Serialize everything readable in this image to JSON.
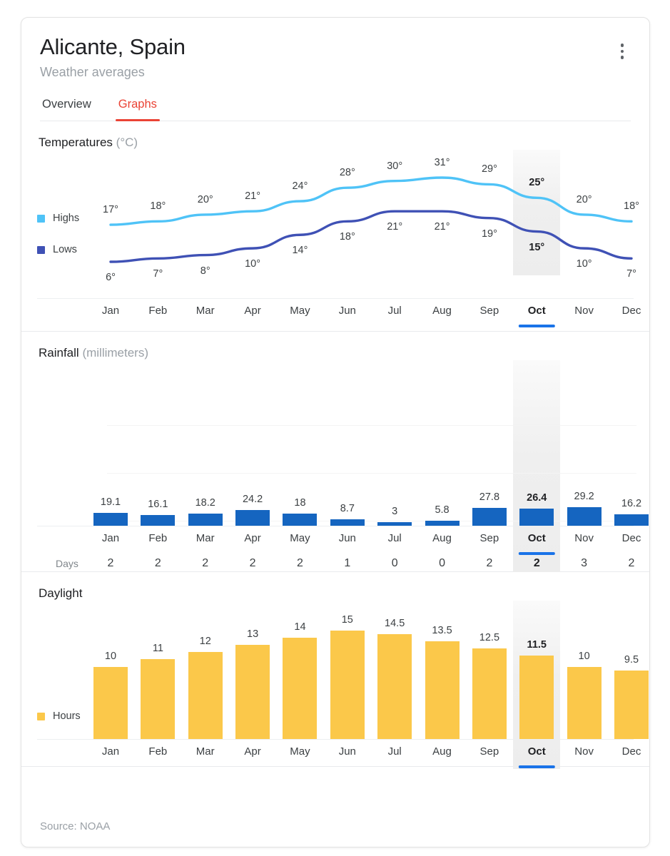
{
  "header": {
    "title": "Alicante, Spain",
    "subtitle": "Weather averages",
    "menu_icon": "more-vert-icon"
  },
  "tabs": [
    {
      "label": "Overview",
      "active": false
    },
    {
      "label": "Graphs",
      "active": true
    }
  ],
  "accent_color": "#ea4335",
  "selected_month": "Oct",
  "selected_index": 9,
  "footer": {
    "source": "Source: NOAA"
  },
  "sections": {
    "temperatures": {
      "title": "Temperatures",
      "unit": "(°C)"
    },
    "rainfall": {
      "title": "Rainfall",
      "unit": "(millimeters)"
    },
    "daylight": {
      "title": "Daylight",
      "unit": ""
    }
  },
  "rainfall_days_label": "Days",
  "chart_data": [
    {
      "type": "line",
      "title": "Temperatures (°C)",
      "xlabel": "",
      "ylabel": "°C",
      "categories": [
        "Jan",
        "Feb",
        "Mar",
        "Apr",
        "May",
        "Jun",
        "Jul",
        "Aug",
        "Sep",
        "Oct",
        "Nov",
        "Dec"
      ],
      "series": [
        {
          "name": "Highs",
          "color": "#4FC3F7",
          "values": [
            17,
            18,
            20,
            21,
            24,
            28,
            30,
            31,
            29,
            25,
            20,
            18
          ],
          "labels": [
            "17°",
            "18°",
            "20°",
            "21°",
            "24°",
            "28°",
            "30°",
            "31°",
            "29°",
            "25°",
            "20°",
            "18°"
          ]
        },
        {
          "name": "Lows",
          "color": "#3F51B5",
          "values": [
            6,
            7,
            8,
            10,
            14,
            18,
            21,
            21,
            19,
            15,
            10,
            7
          ],
          "labels": [
            "6°",
            "7°",
            "8°",
            "10°",
            "14°",
            "18°",
            "21°",
            "21°",
            "19°",
            "15°",
            "10°",
            "7°"
          ]
        }
      ],
      "ylim": [
        0,
        35
      ],
      "grid": false,
      "legend": "left"
    },
    {
      "type": "bar",
      "title": "Rainfall (millimeters)",
      "xlabel": "",
      "ylabel": "millimeters",
      "categories": [
        "Jan",
        "Feb",
        "Mar",
        "Apr",
        "May",
        "Jun",
        "Jul",
        "Aug",
        "Sep",
        "Oct",
        "Nov",
        "Dec"
      ],
      "values": [
        19.1,
        16.1,
        18.2,
        24.2,
        18,
        8.7,
        3,
        5.8,
        27.8,
        26.4,
        29.2,
        16.2
      ],
      "labels": [
        "19.1",
        "16.1",
        "18.2",
        "24.2",
        "18",
        "8.7",
        "3",
        "5.8",
        "27.8",
        "26.4",
        "29.2",
        "16.2"
      ],
      "color": "#1565C0",
      "ylim": [
        0,
        160
      ],
      "grid": true,
      "gridlines": 3,
      "secondary_row": {
        "name": "Days",
        "values": [
          2,
          2,
          2,
          2,
          2,
          1,
          0,
          0,
          2,
          2,
          3,
          2
        ],
        "labels": [
          "2",
          "2",
          "2",
          "2",
          "2",
          "1",
          "0",
          "0",
          "2",
          "2",
          "3",
          "2"
        ]
      }
    },
    {
      "type": "bar",
      "title": "Daylight",
      "xlabel": "",
      "ylabel": "Hours",
      "categories": [
        "Jan",
        "Feb",
        "Mar",
        "Apr",
        "May",
        "Jun",
        "Jul",
        "Aug",
        "Sep",
        "Oct",
        "Nov",
        "Dec"
      ],
      "values": [
        10,
        11,
        12,
        13,
        14,
        15,
        14.5,
        13.5,
        12.5,
        11.5,
        10,
        9.5
      ],
      "labels": [
        "10",
        "11",
        "12",
        "13",
        "14",
        "15",
        "14.5",
        "13.5",
        "12.5",
        "11.5",
        "10",
        "9.5"
      ],
      "color": "#FBC84A",
      "legend_label": "Hours",
      "ylim": [
        0,
        16.5
      ],
      "grid": false
    }
  ]
}
